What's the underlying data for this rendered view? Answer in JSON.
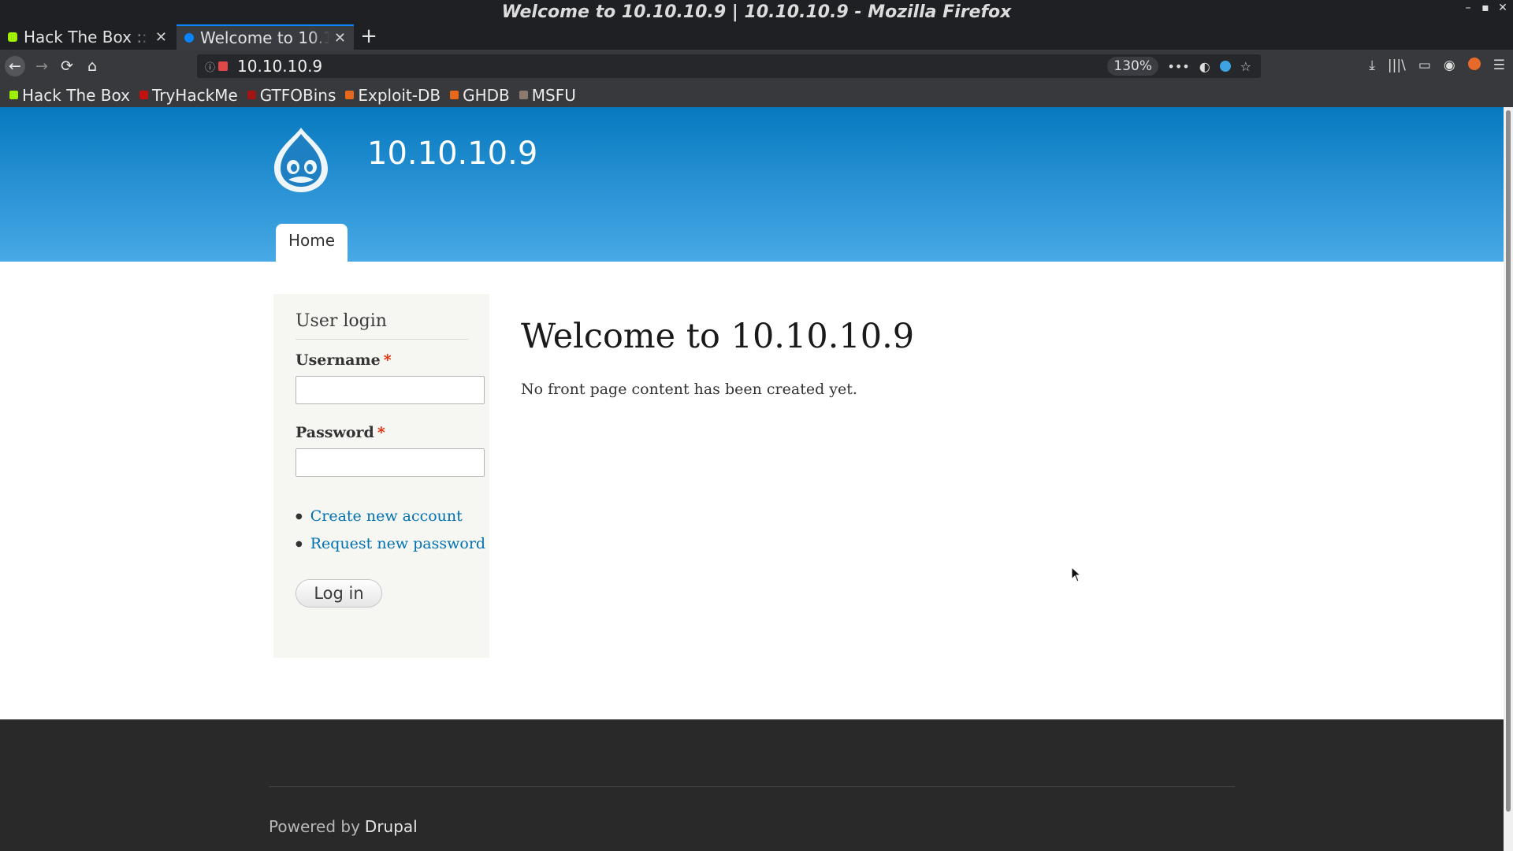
{
  "window": {
    "title": "Welcome to 10.10.10.9 | 10.10.10.9 - Mozilla Firefox",
    "controls": {
      "minimize": "–",
      "maximize": "▪",
      "close": "✕"
    }
  },
  "tabs": [
    {
      "label": "Hack The Box :: M",
      "close": "✕",
      "active": false,
      "favicon_color": "#9fef00"
    },
    {
      "label": "Welcome to 10.1",
      "close": "✕",
      "active": true,
      "favicon_color": "#0a84ff"
    }
  ],
  "newtab_label": "+",
  "toolbar": {
    "back": "←",
    "forward": "→",
    "reload": "⟳",
    "home": "⌂",
    "url": "10.10.10.9",
    "zoom": "130%",
    "more": "•••",
    "pocket": "◐",
    "star": "☆",
    "download": "⤓",
    "library": "|||\\",
    "sidebar": "▭",
    "account": "◉",
    "menu": "☰"
  },
  "bookmarks": [
    {
      "label": "Hack The Box",
      "icon": "htb-icon",
      "color": "#9fef00"
    },
    {
      "label": "TryHackMe",
      "icon": "thm-icon",
      "color": "#c11111"
    },
    {
      "label": "GTFOBins",
      "icon": "gtfobins-icon",
      "color": "#a31515"
    },
    {
      "label": "Exploit-DB",
      "icon": "exploitdb-icon",
      "color": "#e8681b"
    },
    {
      "label": "GHDB",
      "icon": "ghdb-icon",
      "color": "#e8681b"
    },
    {
      "label": "MSFU",
      "icon": "msfu-icon",
      "color": "#8a7a70"
    }
  ],
  "site": {
    "name": "10.10.10.9",
    "nav_home": "Home",
    "login": {
      "title": "User login",
      "username_label": "Username",
      "password_label": "Password",
      "required_mark": "*",
      "links": [
        "Create new account",
        "Request new password"
      ],
      "submit": "Log in"
    },
    "main_title": "Welcome to 10.10.10.9",
    "main_text": "No front page content has been created yet.",
    "footer": {
      "powered_by": "Powered by",
      "drupal": "Drupal"
    }
  },
  "colors": {
    "header_top": "#0779bf",
    "header_bottom": "#48a9e6",
    "link": "#0071b3",
    "required": "#e32700"
  }
}
